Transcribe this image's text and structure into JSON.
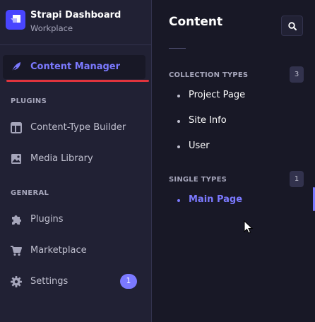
{
  "brand": {
    "title": "Strapi Dashboard",
    "subtitle": "Workplace"
  },
  "sidebar": {
    "items": [
      {
        "label": "Content Manager",
        "icon": "feather-icon",
        "active": true
      }
    ],
    "sections": [
      {
        "label": "PLUGINS",
        "items": [
          {
            "label": "Content-Type Builder",
            "icon": "layout-icon"
          },
          {
            "label": "Media Library",
            "icon": "image-icon"
          }
        ]
      },
      {
        "label": "GENERAL",
        "items": [
          {
            "label": "Plugins",
            "icon": "puzzle-icon"
          },
          {
            "label": "Marketplace",
            "icon": "cart-icon"
          },
          {
            "label": "Settings",
            "icon": "gear-icon",
            "badge": "1"
          }
        ]
      }
    ]
  },
  "content": {
    "title": "Content",
    "search_icon": "search-icon",
    "collection_types": {
      "label": "COLLECTION TYPES",
      "count": "3",
      "items": [
        "Project Page",
        "Site Info",
        "User"
      ]
    },
    "single_types": {
      "label": "SINGLE TYPES",
      "count": "1",
      "items": [
        "Main Page"
      ],
      "active_item": "Main Page"
    }
  },
  "colors": {
    "accent": "#7b79ff",
    "brand": "#4945ff",
    "sidebar_bg": "#212134",
    "panel_bg": "#181826",
    "highlight_underline": "#e0343d"
  }
}
